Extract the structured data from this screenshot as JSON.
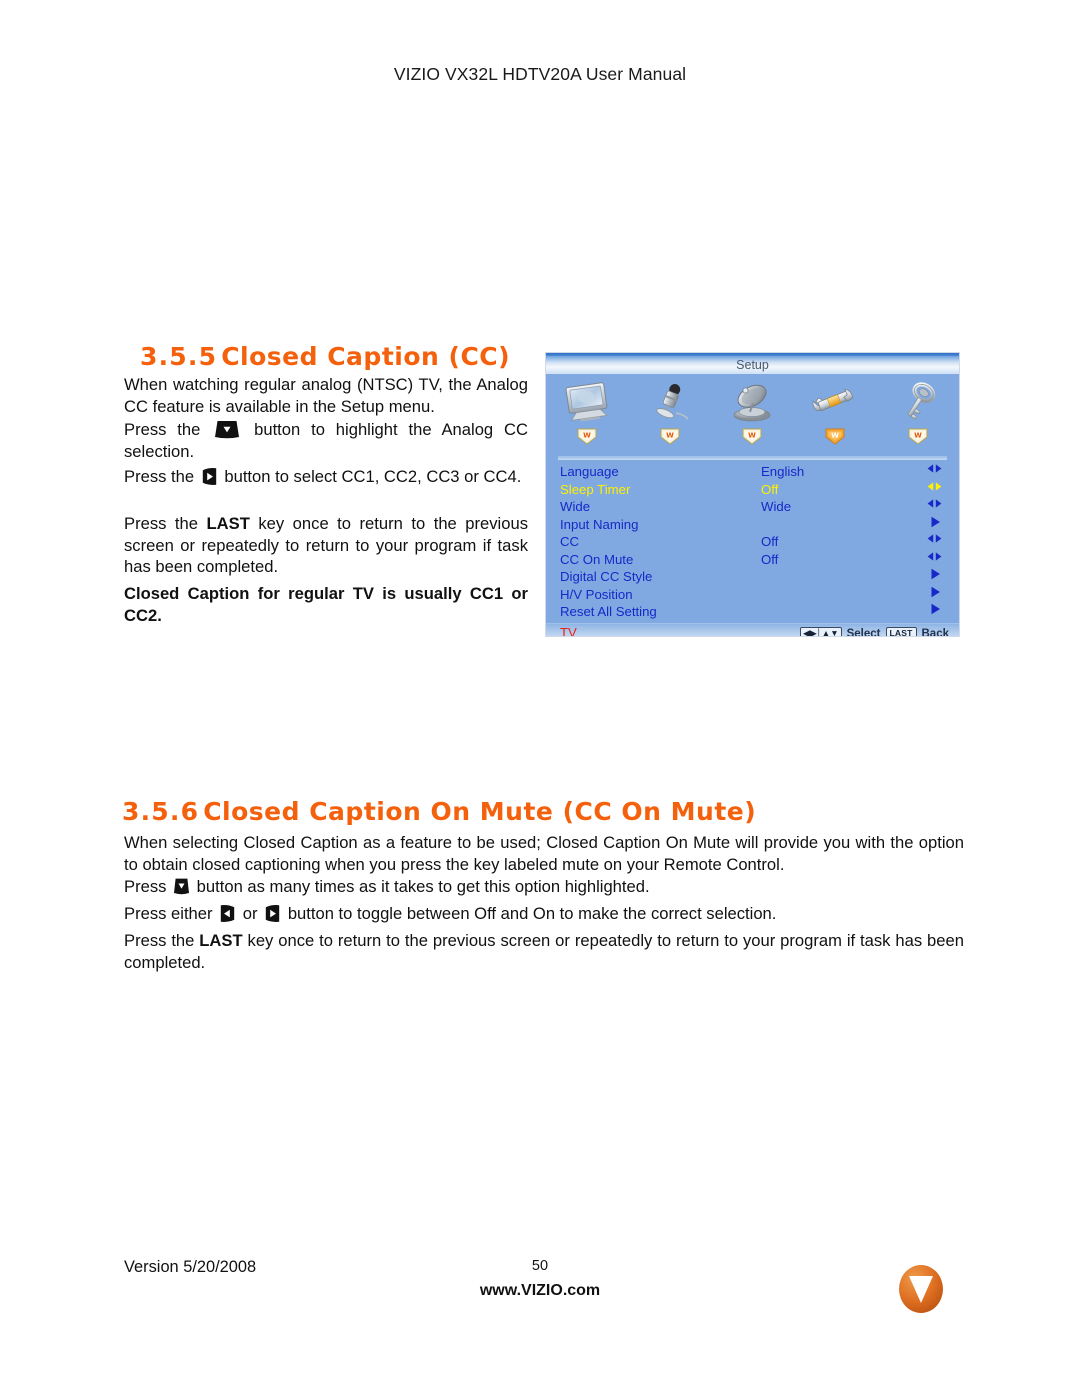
{
  "header": {
    "title": "VIZIO VX32L HDTV20A User Manual"
  },
  "sections": [
    {
      "number": "3.5.5",
      "title": "Closed Caption (CC)",
      "paragraphs": [
        "When watching regular analog (NTSC) TV, the Analog CC feature is available in the Setup menu.",
        "Press the",
        "button to highlight the Analog CC selection.",
        "Press the",
        "button to select CC1, CC2, CC3 or CC4.",
        "Press the",
        "LAST",
        "key once to return to the previous screen or repeatedly to return to your program if task has been completed.",
        "Closed Caption for regular TV is usually CC1 or CC2."
      ]
    },
    {
      "number": "3.5.6",
      "title": "Closed Caption On Mute (CC On Mute)",
      "paragraphs": [
        "When selecting Closed Caption as a feature to be used; Closed Caption On Mute will provide you with the option to obtain closed captioning when you press the key labeled mute on your Remote Control.",
        "Press",
        "button as many times as it takes to get this option highlighted.",
        "Press either",
        "or",
        "button to toggle between Off and On to make the correct selection.",
        "Press the",
        "LAST",
        "key once to return to the previous screen or repeatedly to return to your program if task has been completed."
      ]
    }
  ],
  "osd": {
    "title": "Setup",
    "icons": [
      {
        "name": "picture-icon",
        "label": "Picture"
      },
      {
        "name": "audio-microphone-icon",
        "label": "Audio"
      },
      {
        "name": "satellite-dish-icon",
        "label": "Tuner"
      },
      {
        "name": "wrench-setup-icon",
        "label": "Setup"
      },
      {
        "name": "key-parental-icon",
        "label": "Parental"
      }
    ],
    "active_icon_index": 3,
    "rows": [
      {
        "label": "Language",
        "value": "English",
        "arrow": "leftright",
        "highlighted": false
      },
      {
        "label": "Sleep Timer",
        "value": "Off",
        "arrow": "leftright",
        "highlighted": true
      },
      {
        "label": "Wide",
        "value": "Wide",
        "arrow": "leftright",
        "highlighted": false
      },
      {
        "label": "Input Naming",
        "value": "",
        "arrow": "right",
        "highlighted": false
      },
      {
        "label": "CC",
        "value": "Off",
        "arrow": "leftright",
        "highlighted": false
      },
      {
        "label": "CC On Mute",
        "value": "Off",
        "arrow": "leftright",
        "highlighted": false
      },
      {
        "label": "Digital CC Style",
        "value": "",
        "arrow": "right",
        "highlighted": false
      },
      {
        "label": "H/V Position",
        "value": "",
        "arrow": "right",
        "highlighted": false
      },
      {
        "label": "Reset All Setting",
        "value": "",
        "arrow": "right",
        "highlighted": false
      }
    ],
    "footer": {
      "source": "TV",
      "nav_key": "◀▶│▲▼",
      "select_label": "Select",
      "last_key": "LAST",
      "back_label": "Back"
    },
    "colors": {
      "background": "#7FA9E0",
      "label": "#1828C8",
      "highlight": "#FFF000",
      "source": "#E8201A"
    }
  },
  "footer": {
    "version": "Version 5/20/2008",
    "page_number": "50",
    "website": "www.VIZIO.com",
    "logo_color": "#D9661F"
  }
}
